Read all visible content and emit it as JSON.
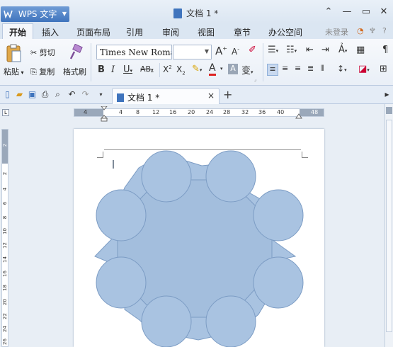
{
  "title_bar": {
    "app_name": "WPS 文字",
    "document_title": "文档 1 *"
  },
  "menu": {
    "items": [
      "开始",
      "插入",
      "页面布局",
      "引用",
      "审阅",
      "视图",
      "章节",
      "办公空间"
    ],
    "login": "未登录"
  },
  "ribbon": {
    "paste_label": "粘贴",
    "cut_label": "剪切",
    "copy_label": "复制",
    "format_painter_label": "格式刷",
    "font_name": "Times New Roma",
    "font_size": ""
  },
  "tabs": {
    "document_tab": "文档 1 *",
    "close": "×",
    "add": "+"
  },
  "ruler": {
    "horizontal_ticks": [
      "4",
      "4",
      "8",
      "12",
      "16",
      "20",
      "24",
      "28",
      "32",
      "36",
      "40",
      "48"
    ],
    "vertical_ticks": [
      "2",
      "2",
      "4",
      "6",
      "8",
      "10",
      "12",
      "14",
      "16",
      "18",
      "20",
      "22",
      "24",
      "26"
    ]
  },
  "colors": {
    "shape_fill": "#a9c3e1",
    "shape_stroke": "#7c9cc4",
    "accent": "#3f74bd"
  }
}
